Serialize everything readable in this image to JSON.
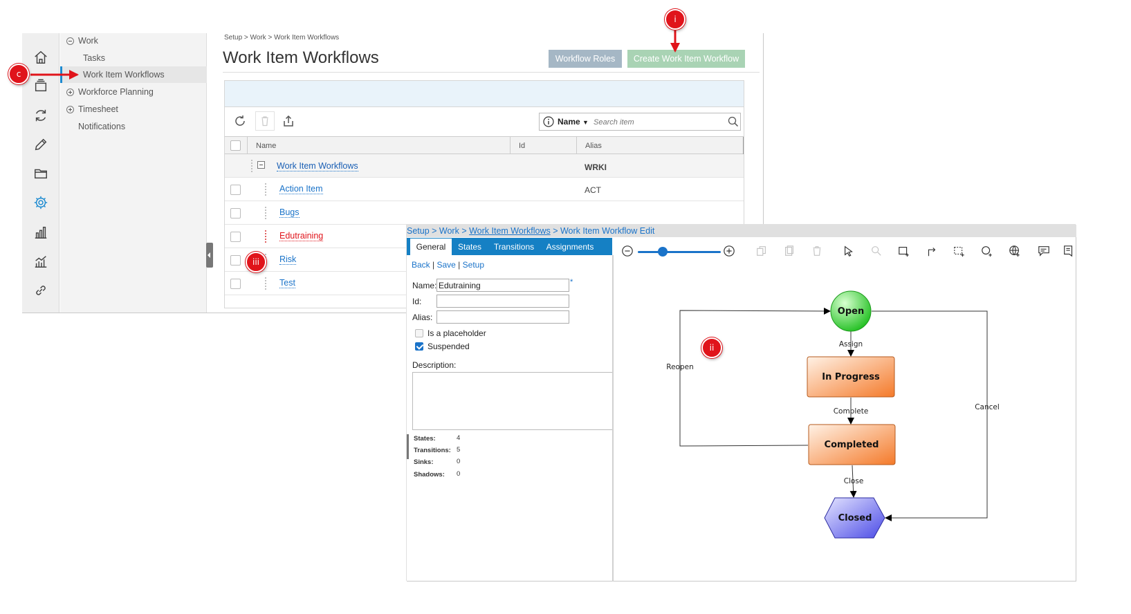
{
  "back_window": {
    "subnav": {
      "work": "Work",
      "tasks": "Tasks",
      "work_item_workflows": "Work Item Workflows",
      "workforce_planning": "Workforce Planning",
      "timesheet": "Timesheet",
      "notifications": "Notifications"
    },
    "rail_icons": [
      "home-icon",
      "layers-icon",
      "sync-icon",
      "pencil-icon",
      "folder-icon",
      "gear-icon",
      "bar-chart-icon",
      "analytics-icon",
      "link-icon"
    ],
    "breadcrumb": "Setup > Work > Work Item Workflows",
    "title": "Work Item Workflows",
    "buttons": {
      "roles": "Workflow Roles",
      "create": "Create Work Item Workflow"
    },
    "search": {
      "field": "Name",
      "placeholder": "Search item"
    },
    "columns": [
      "Name",
      "Id",
      "Alias"
    ],
    "group_row": {
      "name": "Work Item Workflows",
      "alias": "WRKI"
    },
    "rows": [
      {
        "name": "Action Item",
        "alias": "ACT"
      },
      {
        "name": "Bugs",
        "alias": ""
      },
      {
        "name": "Edutraining",
        "alias": ""
      },
      {
        "name": "Risk",
        "alias": ""
      },
      {
        "name": "Test",
        "alias": ""
      }
    ]
  },
  "editor": {
    "breadcrumb": {
      "p1": "Setup > Work > ",
      "p2": "Work Item Workflows",
      "p3": " > Work Item Workflow Edit"
    },
    "tabs": [
      "General",
      "States",
      "Transitions",
      "Assignments"
    ],
    "links": {
      "back": "Back",
      "save": "Save",
      "setup": "Setup",
      "sep": " | "
    },
    "form": {
      "name_label": "Name:",
      "name_value": "Edutraining",
      "required": "*",
      "id_label": "Id:",
      "id_value": "",
      "alias_label": "Alias:",
      "alias_value": "",
      "placeholder_label": "Is a placeholder",
      "suspended_label": "Suspended",
      "description_label": "Description:"
    },
    "stats": [
      {
        "label": "States:",
        "value": "4"
      },
      {
        "label": "Transitions:",
        "value": "5"
      },
      {
        "label": "Sinks:",
        "value": "0"
      },
      {
        "label": "Shadows:",
        "value": "0"
      }
    ],
    "zoom_level": 0.3
  },
  "diagram": {
    "states": {
      "open": "Open",
      "in_progress": "In Progress",
      "completed": "Completed",
      "closed": "Closed"
    },
    "transitions": {
      "assign": "Assign",
      "complete": "Complete",
      "close": "Close",
      "reopen": "Reopen",
      "cancel": "Cancel"
    },
    "colors": {
      "open": "#22c022",
      "task": "#f47a2a",
      "closed": "#4b4be6"
    }
  },
  "annotations": {
    "c": "c",
    "i": "i",
    "ii": "ii",
    "iii": "iii"
  }
}
